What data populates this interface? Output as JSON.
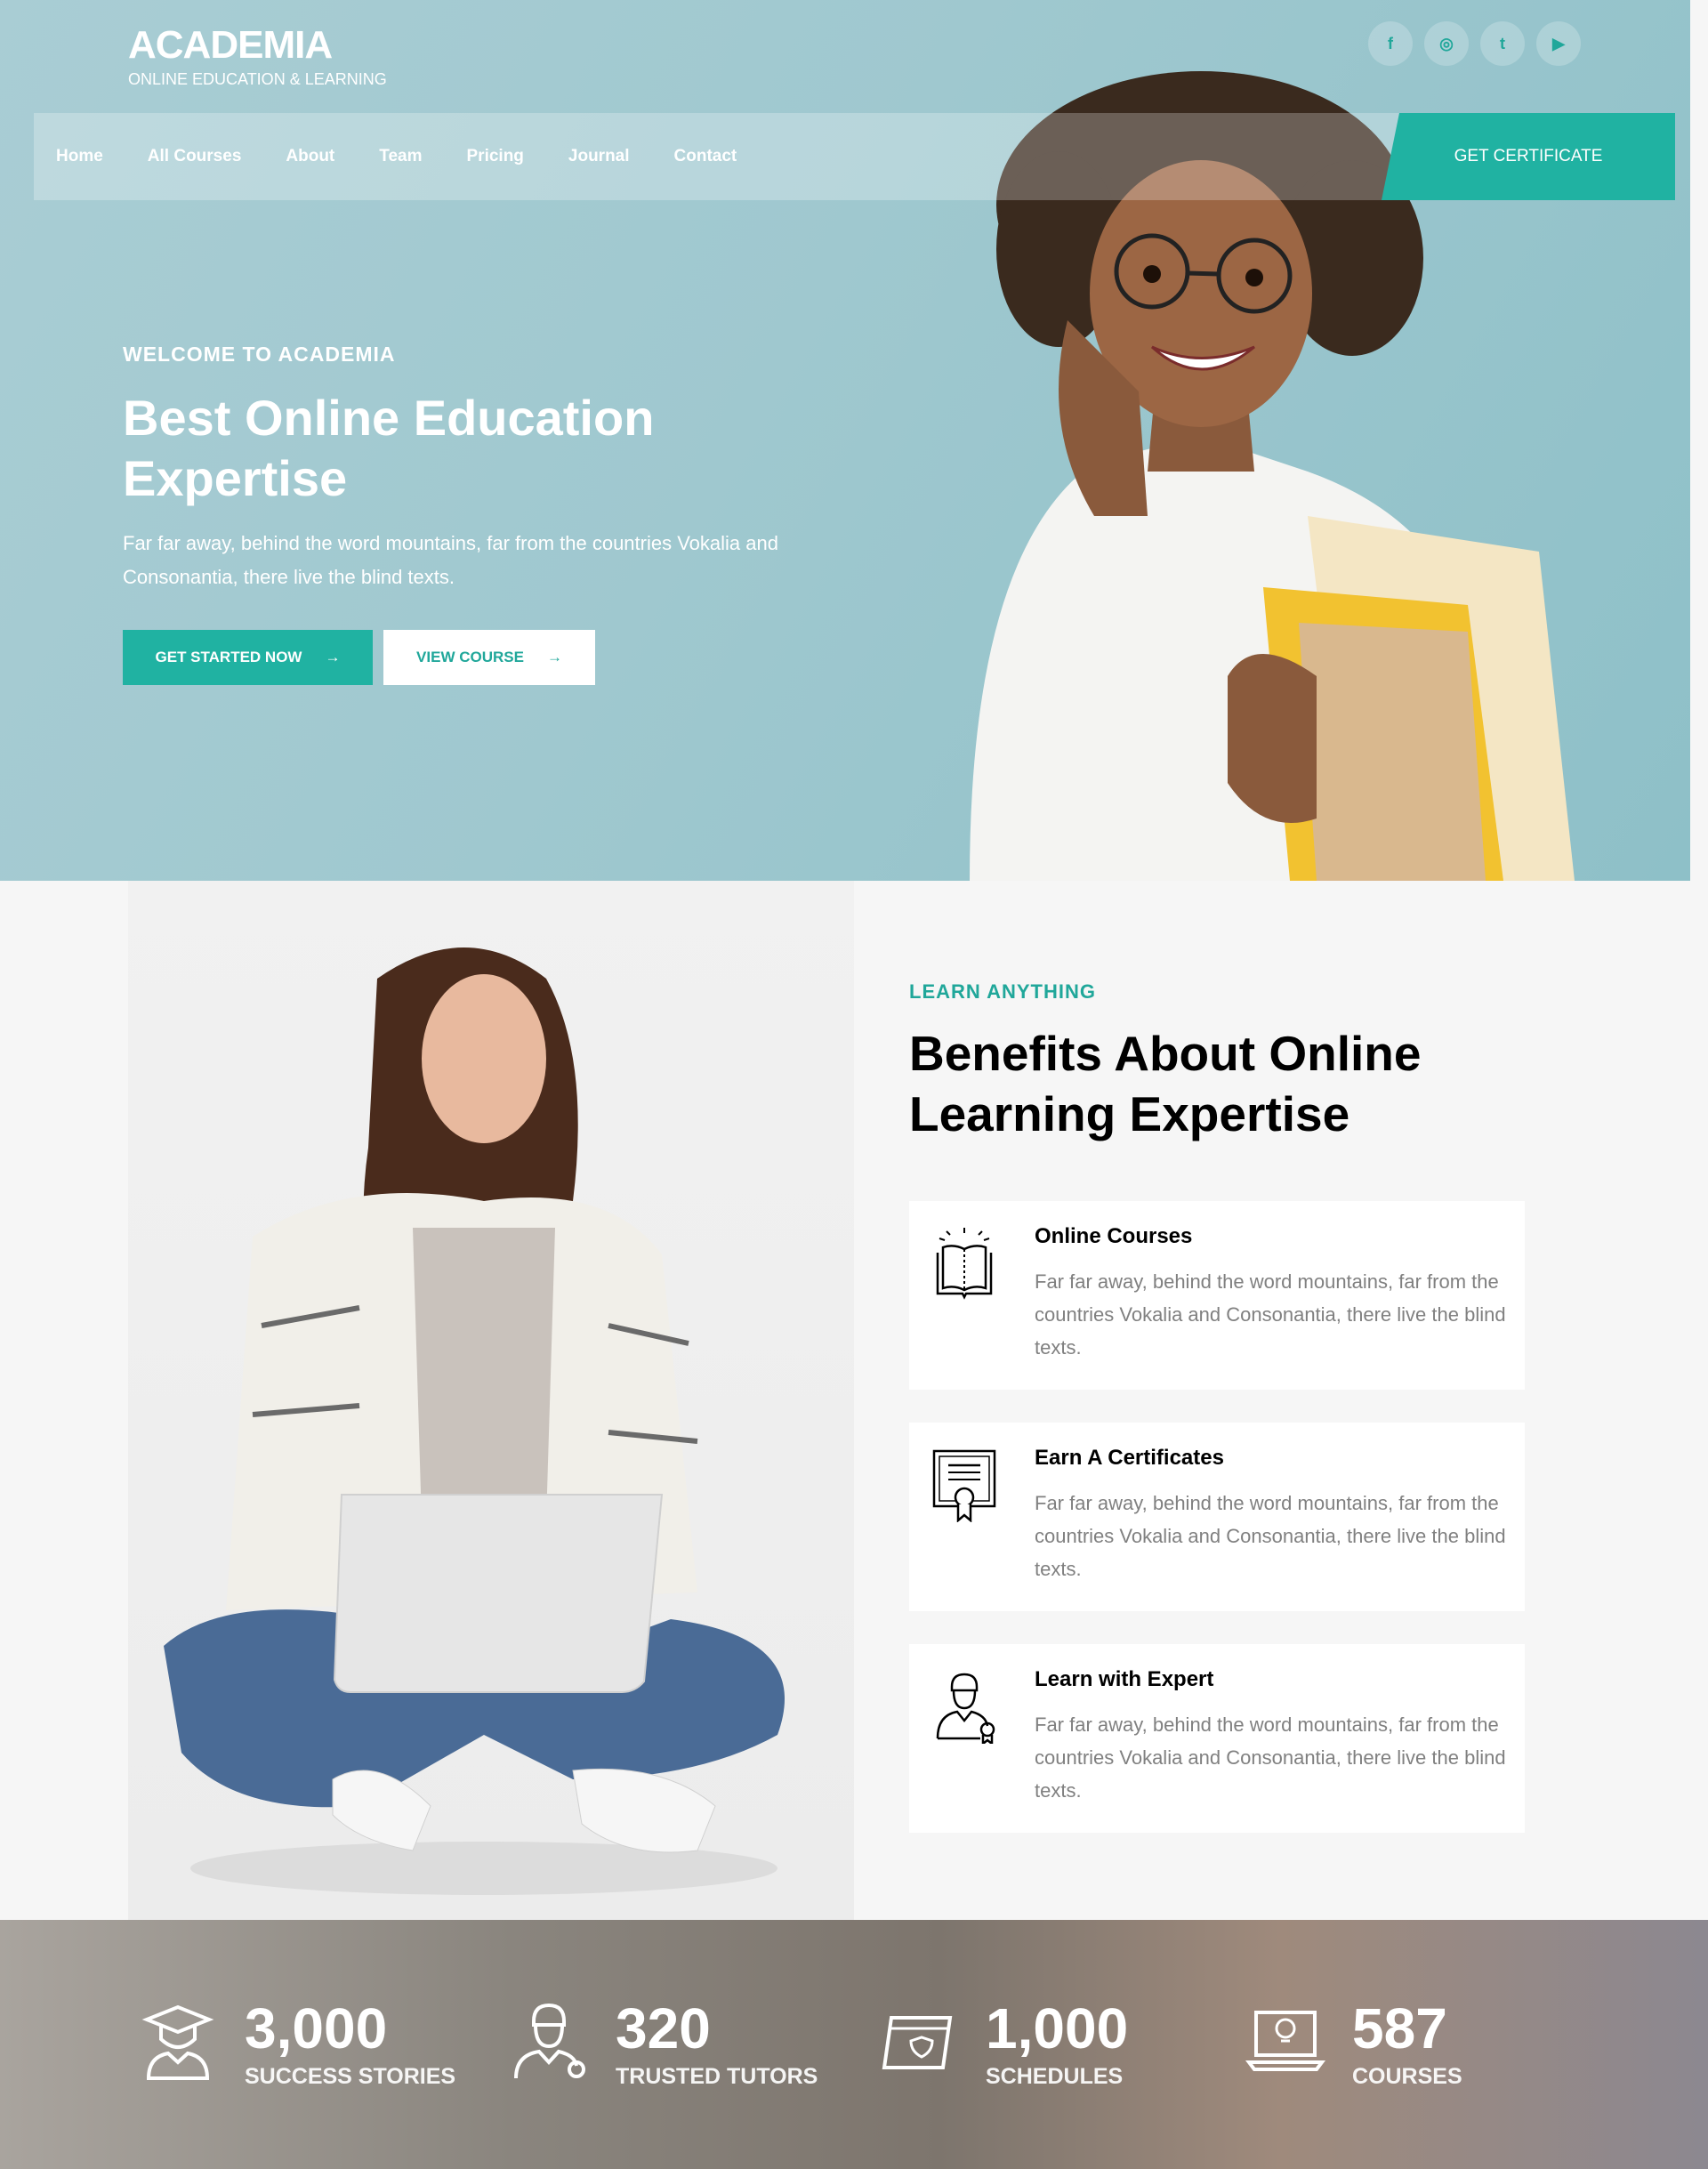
{
  "brand": {
    "name": "ACADEMIA",
    "tagline": "ONLINE EDUCATION & LEARNING"
  },
  "socials": [
    {
      "icon": "facebook-icon",
      "glyph": "f"
    },
    {
      "icon": "instagram-icon",
      "glyph": "◎"
    },
    {
      "icon": "twitter-icon",
      "glyph": "t"
    },
    {
      "icon": "youtube-icon",
      "glyph": "▶"
    }
  ],
  "nav": {
    "items": [
      "Home",
      "All Courses",
      "About",
      "Team",
      "Pricing",
      "Journal",
      "Contact"
    ],
    "cta": "GET CERTIFICATE"
  },
  "hero": {
    "kicker": "WELCOME TO ACADEMIA",
    "title": "Best Online Education Expertise",
    "description": "Far far away, behind the word mountains, far from the countries Vokalia and Consonantia, there live the blind texts.",
    "primary_button": "GET STARTED NOW",
    "secondary_button": "VIEW COURSE",
    "arrow": "→"
  },
  "benefits": {
    "kicker": "LEARN ANYTHING",
    "title": "Benefits About Online Learning Expertise",
    "cards": [
      {
        "icon": "open-book-icon",
        "title": "Online Courses",
        "description": "Far far away, behind the word mountains, far from the countries Vokalia and Consonantia, there live the blind texts."
      },
      {
        "icon": "certificate-icon",
        "title": "Earn A Certificates",
        "description": "Far far away, behind the word mountains, far from the countries Vokalia and Consonantia, there live the blind texts."
      },
      {
        "icon": "expert-icon",
        "title": "Learn with Expert",
        "description": "Far far away, behind the word mountains, far from the countries Vokalia and Consonantia, there live the blind texts."
      }
    ]
  },
  "stats": [
    {
      "icon": "graduate-icon",
      "value": "3,000",
      "label": "SUCCESS STORIES"
    },
    {
      "icon": "tutor-icon",
      "value": "320",
      "label": "TRUSTED TUTORS"
    },
    {
      "icon": "calendar-icon",
      "value": "1,000",
      "label": "SCHEDULES"
    },
    {
      "icon": "laptop-idea-icon",
      "value": "587",
      "label": "COURSES"
    }
  ],
  "colors": {
    "accent": "#20b2a2",
    "hero_bg": "#a3cbd2",
    "muted_text": "#808080"
  }
}
